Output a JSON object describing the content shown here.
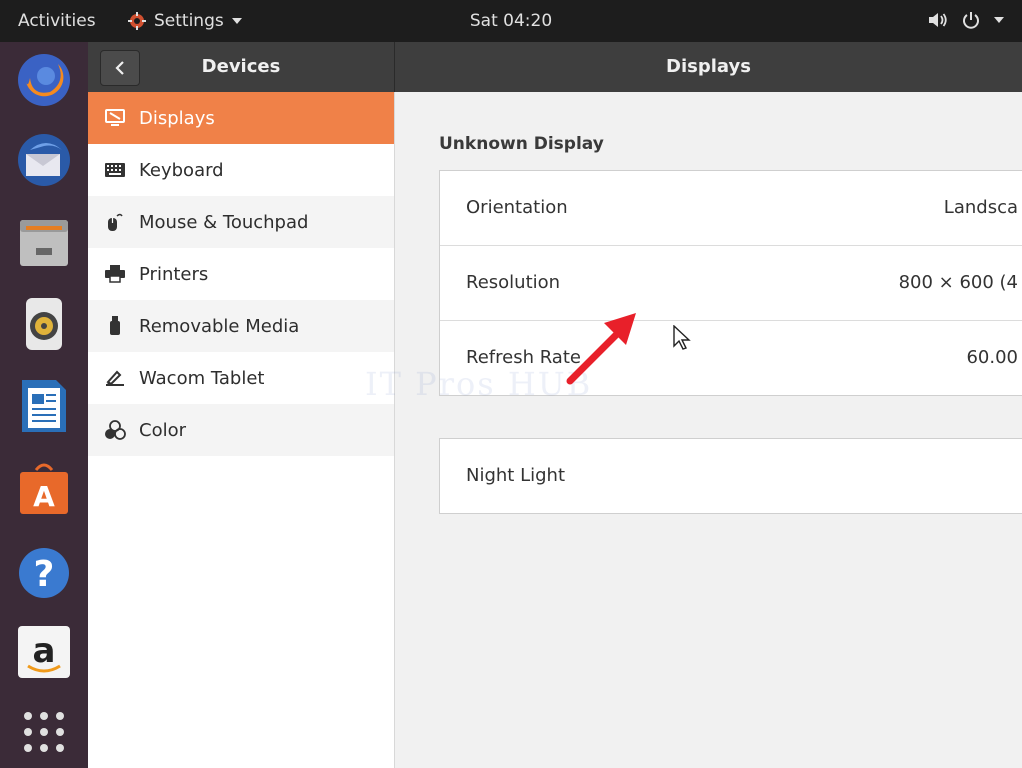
{
  "topbar": {
    "activities": "Activities",
    "app_menu": "Settings",
    "clock": "Sat 04:20"
  },
  "dock": {
    "items": [
      "firefox-icon",
      "thunderbird-icon",
      "files-icon",
      "rhythmbox-icon",
      "writer-icon",
      "software-icon",
      "help-icon",
      "amazon-icon",
      "show-apps-icon"
    ]
  },
  "header": {
    "left_title": "Devices",
    "right_title": "Displays"
  },
  "sidebar": {
    "items": [
      {
        "label": "Displays"
      },
      {
        "label": "Keyboard"
      },
      {
        "label": "Mouse & Touchpad"
      },
      {
        "label": "Printers"
      },
      {
        "label": "Removable Media"
      },
      {
        "label": "Wacom Tablet"
      },
      {
        "label": "Color"
      }
    ]
  },
  "main": {
    "section_title": "Unknown Display",
    "rows": [
      {
        "label": "Orientation",
        "value": "Landsca"
      },
      {
        "label": "Resolution",
        "value": "800 × 600 (4"
      },
      {
        "label": "Refresh Rate",
        "value": "60.00"
      }
    ],
    "night_light": "Night Light"
  },
  "watermark": "IT Pros HUB",
  "colors": {
    "accent": "#f08148",
    "dock": "#3b2b38",
    "arrow": "#e8202a"
  }
}
